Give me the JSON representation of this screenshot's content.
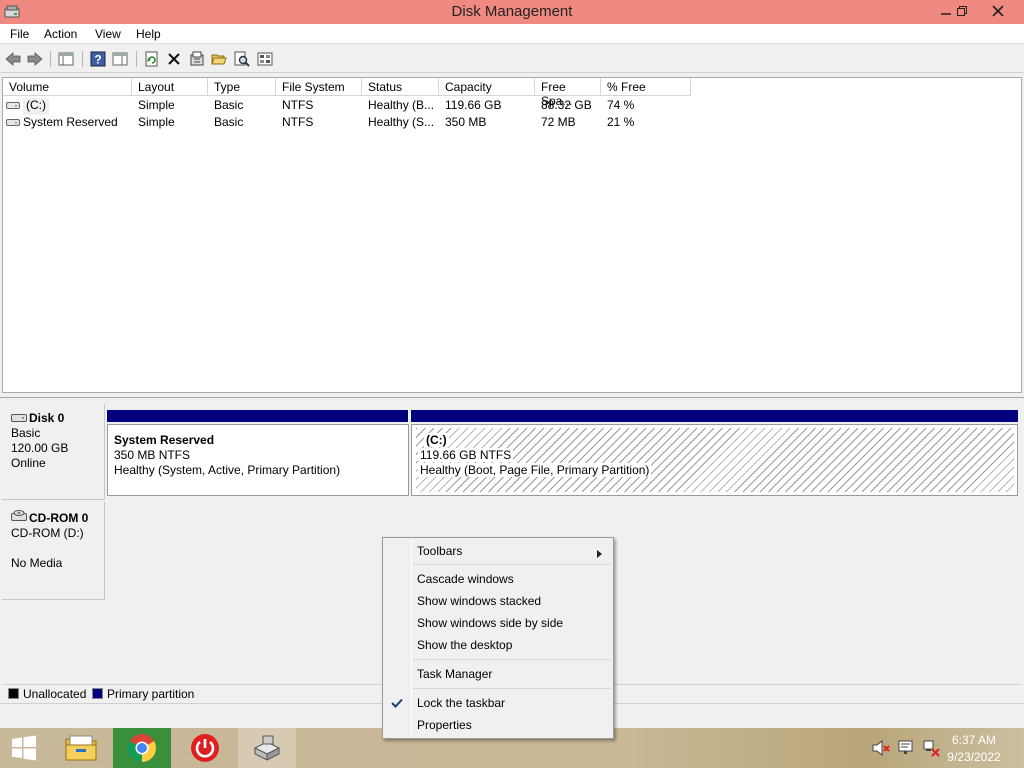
{
  "window": {
    "title": "Disk Management"
  },
  "menu": {
    "items": [
      "File",
      "Action",
      "View",
      "Help"
    ]
  },
  "toolbar_icons": [
    "back-icon",
    "forward-icon",
    "console-tree-icon",
    "help-icon",
    "properties-view-icon",
    "refresh-icon",
    "delete-icon",
    "properties-icon",
    "open-icon",
    "search-icon",
    "export-icon"
  ],
  "volumes": {
    "columns": [
      "Volume",
      "Layout",
      "Type",
      "File System",
      "Status",
      "Capacity",
      "Free Spa...",
      "% Free"
    ],
    "rows": [
      [
        "(C:)",
        "Simple",
        "Basic",
        "NTFS",
        "Healthy (B...",
        "119.66 GB",
        "88.32 GB",
        "74 %"
      ],
      [
        "System Reserved",
        "Simple",
        "Basic",
        "NTFS",
        "Healthy (S...",
        "350 MB",
        "72 MB",
        "21 %"
      ]
    ]
  },
  "disks": {
    "disk0": {
      "name": "Disk 0",
      "type": "Basic",
      "size": "120.00 GB",
      "state": "Online",
      "partitions": [
        {
          "name": "System Reserved",
          "size": "350 MB NTFS",
          "status": "Healthy (System, Active, Primary Partition)"
        },
        {
          "name": "(C:)",
          "size": "119.66 GB NTFS",
          "status": "Healthy (Boot, Page File, Primary Partition)"
        }
      ]
    },
    "cdrom0": {
      "name": "CD-ROM 0",
      "drive": "CD-ROM (D:)",
      "media": "No Media"
    }
  },
  "legend": {
    "unallocated": "Unallocated",
    "primary": "Primary partition",
    "unallocated_color": "#000000",
    "primary_color": "#00007f"
  },
  "context_menu": {
    "toolbars": "Toolbars",
    "cascade": "Cascade windows",
    "stacked": "Show windows stacked",
    "side_by_side": "Show windows side by side",
    "desktop": "Show the desktop",
    "task_manager": "Task Manager",
    "lock_taskbar": "Lock the taskbar",
    "properties": "Properties"
  },
  "taskbar": {
    "time": "6:37 AM",
    "date": "9/23/2022",
    "pinned": [
      "file-explorer-icon",
      "chrome-icon",
      "power-icon",
      "disk-management-icon"
    ]
  },
  "colors": {
    "titlebar": "#f08a80",
    "partition_bar": "#00007f"
  }
}
